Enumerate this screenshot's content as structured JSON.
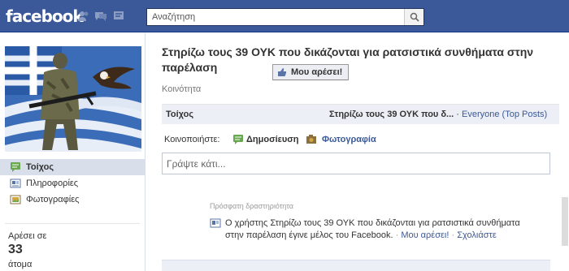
{
  "topbar": {
    "logo": "facebook",
    "search_placeholder": "Αναζήτηση"
  },
  "page": {
    "title": "Στηρίζω τους 39 ΟΥΚ που δικάζονται για ρατσιστικά συνθήματα στην παρέλαση",
    "like_button": "Μου αρέσει!",
    "category": "Κοινότητα"
  },
  "sidebar": {
    "items": [
      {
        "label": "Τοίχος",
        "icon": "wall-icon",
        "active": true
      },
      {
        "label": "Πληροφορίες",
        "icon": "info-icon",
        "active": false
      },
      {
        "label": "Φωτογραφίες",
        "icon": "photos-icon",
        "active": false
      }
    ],
    "likes_label": "Αρέσει σε",
    "likes_count": "33",
    "likes_unit": "άτομα"
  },
  "wall": {
    "tab_label": "Τοίχος",
    "filter_page": "Στηρίζω τους 39 ΟΥΚ που δ...",
    "filter_separator": "·",
    "filter_everyone": "Everyone (Top Posts)"
  },
  "share": {
    "label": "Κοινοποιήστε:",
    "status": "Δημοσίευση",
    "photo": "Φωτογραφία",
    "composer_placeholder": "Γράψτε κάτι..."
  },
  "recent": {
    "label": "Πρόσφατη δραστηριότητα",
    "text": "Ο χρήστης Στηρίζω τους 39 ΟΥΚ που δικάζονται για ρατσιστικά συνθήματα στην παρέλαση έγινε μέλος του Facebook.",
    "like_link": "Μου αρέσει!",
    "comment_link": "Σχολιάστε",
    "separator": "·"
  },
  "colors": {
    "brand": "#3b5998",
    "tab_bg": "#eceff5"
  }
}
